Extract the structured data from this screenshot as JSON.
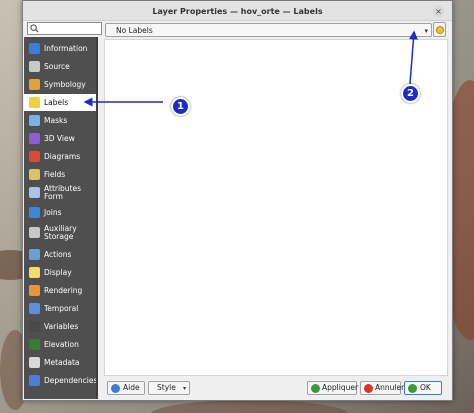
{
  "window": {
    "title": "Layer Properties — hov_orte — Labels",
    "close_glyph": "×"
  },
  "search": {
    "value": "",
    "placeholder": ""
  },
  "sidebar": {
    "items": [
      {
        "label": "Information",
        "icon": "info-icon",
        "color": "#3b7dd8"
      },
      {
        "label": "Source",
        "icon": "wrench-icon",
        "color": "#c9c9c9"
      },
      {
        "label": "Symbology",
        "icon": "brush-icon",
        "color": "#e0a03a"
      },
      {
        "label": "Labels",
        "icon": "abc-label-icon",
        "color": "#f0d040"
      },
      {
        "label": "Masks",
        "icon": "abc-mask-icon",
        "color": "#7ab2e6"
      },
      {
        "label": "3D View",
        "icon": "cube-icon",
        "color": "#8c5fd0"
      },
      {
        "label": "Diagrams",
        "icon": "diagram-icon",
        "color": "#d84a3a"
      },
      {
        "label": "Fields",
        "icon": "fields-icon",
        "color": "#d8c36a"
      },
      {
        "label": "Attributes Form",
        "icon": "form-icon",
        "color": "#a8c4e6"
      },
      {
        "label": "Joins",
        "icon": "joins-icon",
        "color": "#3e86d6"
      },
      {
        "label": "Auxiliary Storage",
        "icon": "storage-icon",
        "color": "#c8c8c8"
      },
      {
        "label": "Actions",
        "icon": "gear-icon",
        "color": "#6aa0d8"
      },
      {
        "label": "Display",
        "icon": "speech-bubble-icon",
        "color": "#f2dc6a"
      },
      {
        "label": "Rendering",
        "icon": "paintbrush-icon",
        "color": "#e8963a"
      },
      {
        "label": "Temporal",
        "icon": "clock-icon",
        "color": "#5d90d6"
      },
      {
        "label": "Variables",
        "icon": "variables-icon",
        "color": "#4a4a4a"
      },
      {
        "label": "Elevation",
        "icon": "elevation-icon",
        "color": "#3a7a3a"
      },
      {
        "label": "Metadata",
        "icon": "metadata-icon",
        "color": "#d8d8d8"
      },
      {
        "label": "Dependencies",
        "icon": "dependencies-icon",
        "color": "#4b7fd4"
      }
    ]
  },
  "labels_panel": {
    "mode_value": "No Labels",
    "dropdown_glyph": "▾"
  },
  "footer": {
    "help_label": "Aide",
    "style_label": "Style",
    "apply_label": "Appliquer",
    "cancel_label": "Annuler",
    "ok_label": "OK",
    "dropdown_glyph": "▾"
  },
  "annotations": {
    "badge_1": "1",
    "badge_2": "2",
    "color": "#1c2cc9"
  }
}
